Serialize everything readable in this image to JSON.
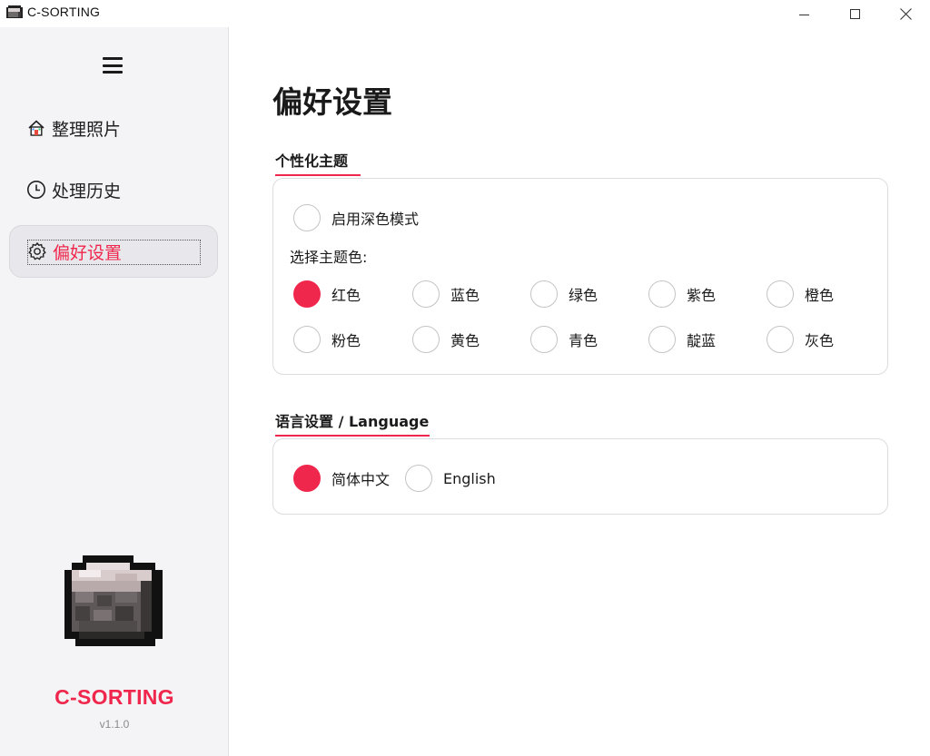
{
  "window": {
    "title": "C-SORTING",
    "icon": "app-cube-icon"
  },
  "sidebar": {
    "menu_icon": "hamburger-menu-icon",
    "items": [
      {
        "label": "整理照片",
        "icon": "home-icon"
      },
      {
        "label": "处理历史",
        "icon": "clock-icon"
      },
      {
        "label": "偏好设置",
        "icon": "gear-icon",
        "selected": true
      }
    ],
    "brand": "C-SORTING",
    "version": "v1.1.0"
  },
  "main": {
    "page_title": "偏好设置",
    "theme_section": {
      "title": "个性化主题",
      "dark_mode_label": "启用深色模式",
      "dark_mode_enabled": false,
      "choose_color_label": "选择主题色:",
      "colors": [
        {
          "label": "红色",
          "selected": true
        },
        {
          "label": "蓝色",
          "selected": false
        },
        {
          "label": "绿色",
          "selected": false
        },
        {
          "label": "紫色",
          "selected": false
        },
        {
          "label": "橙色",
          "selected": false
        },
        {
          "label": "粉色",
          "selected": false
        },
        {
          "label": "黄色",
          "selected": false
        },
        {
          "label": "青色",
          "selected": false
        },
        {
          "label": "靛蓝",
          "selected": false
        },
        {
          "label": "灰色",
          "selected": false
        }
      ]
    },
    "language_section": {
      "title": "语言设置 / Language",
      "options": [
        {
          "label": "简体中文",
          "selected": true
        },
        {
          "label": "English",
          "selected": false
        }
      ]
    }
  },
  "colors": {
    "accent": "#f0274d",
    "sidebar_bg": "#f4f4f6",
    "border": "#dcdce0"
  }
}
